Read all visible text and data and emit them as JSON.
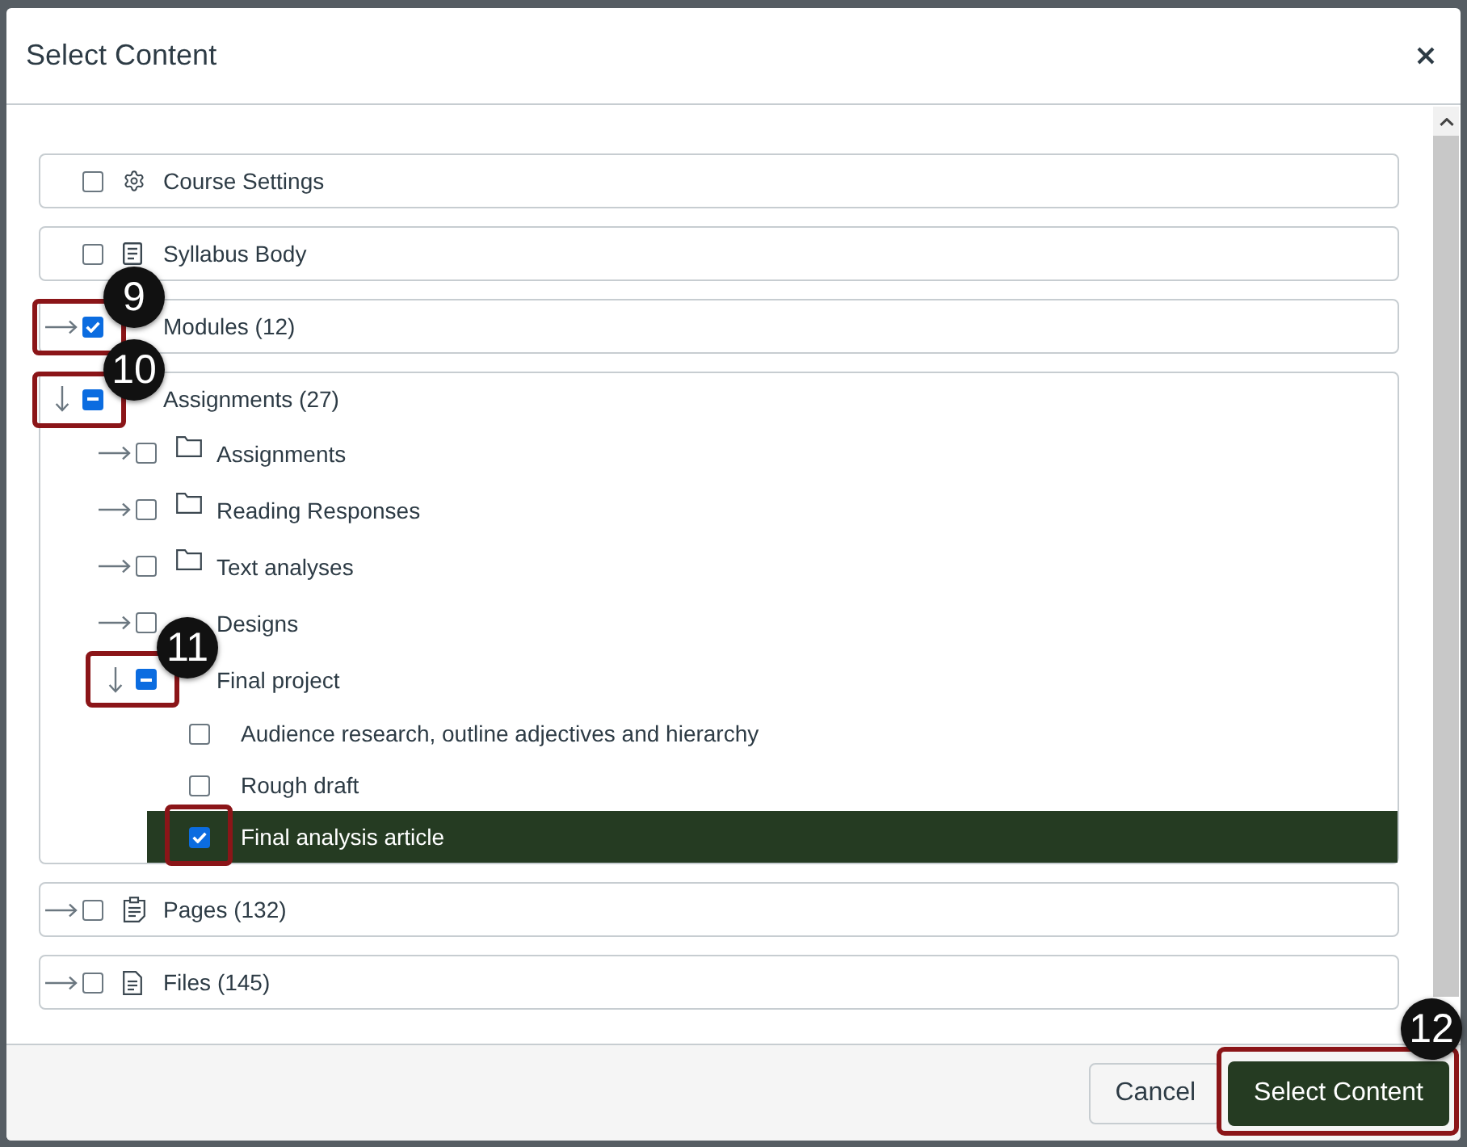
{
  "dialog": {
    "title": "Select Content"
  },
  "items": [
    {
      "label": "Course Settings",
      "kind": "settings",
      "checked": false,
      "indeterminate": false,
      "selected": false,
      "highlighted": false
    },
    {
      "label": "Syllabus Body",
      "kind": "syllabus",
      "checked": false,
      "indeterminate": false,
      "selected": false,
      "highlighted": false
    },
    {
      "label": "Modules (12)",
      "expanded": false,
      "checked": true,
      "indeterminate": false,
      "selected": false,
      "highlighted": true,
      "callout": "9"
    },
    {
      "label": "Assignments (27)",
      "expanded": true,
      "checked": true,
      "indeterminate": true,
      "selected": false,
      "highlighted": true,
      "callout": "10",
      "children": [
        {
          "label": "Assignments",
          "kind": "folder",
          "expanded": false,
          "checked": false,
          "indeterminate": false,
          "selected": false,
          "highlighted": false
        },
        {
          "label": "Reading Responses",
          "kind": "folder",
          "expanded": false,
          "checked": false,
          "indeterminate": false,
          "selected": false,
          "highlighted": false
        },
        {
          "label": "Text analyses",
          "kind": "folder",
          "expanded": false,
          "checked": false,
          "indeterminate": false,
          "selected": false,
          "highlighted": false
        },
        {
          "label": "Designs",
          "expanded": false,
          "checked": false,
          "indeterminate": false,
          "selected": false,
          "highlighted": false
        },
        {
          "label": "Final project",
          "expanded": true,
          "checked": true,
          "indeterminate": true,
          "selected": false,
          "highlighted": true,
          "callout": "11",
          "children": [
            {
              "label": "Audience research, outline adjectives and hierarchy",
              "checked": false,
              "indeterminate": false,
              "selected": false,
              "highlighted": false
            },
            {
              "label": "Rough draft",
              "checked": false,
              "indeterminate": false,
              "selected": false,
              "highlighted": false
            },
            {
              "label": "Final analysis article",
              "checked": true,
              "indeterminate": false,
              "selected": true,
              "highlighted": true
            }
          ]
        }
      ]
    },
    {
      "label": "Pages (132)",
      "kind": "pages",
      "expanded": false,
      "checked": false,
      "indeterminate": false,
      "selected": false,
      "highlighted": false
    },
    {
      "label": "Files (145)",
      "kind": "files",
      "expanded": false,
      "checked": false,
      "indeterminate": false,
      "selected": false,
      "highlighted": false
    }
  ],
  "buttons": [
    {
      "label": "Cancel",
      "kind": "secondary",
      "highlighted": false
    },
    {
      "label": "Select Content",
      "kind": "primary",
      "highlighted": true,
      "callout": "12"
    }
  ]
}
